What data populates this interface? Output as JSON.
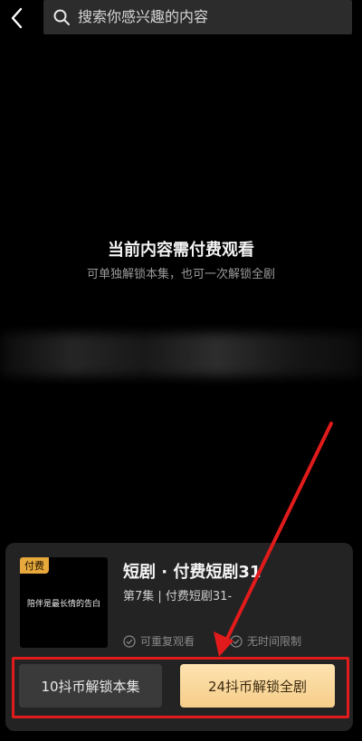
{
  "search": {
    "placeholder": "搜索你感兴趣的内容"
  },
  "paywall": {
    "title": "当前内容需付费观看",
    "subtitle": "可单独解锁本集，也可一次解锁全剧"
  },
  "card": {
    "tag": "付费",
    "poster_text": "陪伴是最长情的告白",
    "title": "短剧 · 付费短剧31",
    "episode": "第7集 | 付费短剧31-",
    "features": [
      "可重复观看",
      "无时间限制"
    ],
    "unlock_episode": "10抖币解锁本集",
    "unlock_all": "24抖币解锁全剧"
  },
  "colors": {
    "accent_gold": "#f6cd8a",
    "annotation_red": "#e11b1b"
  }
}
